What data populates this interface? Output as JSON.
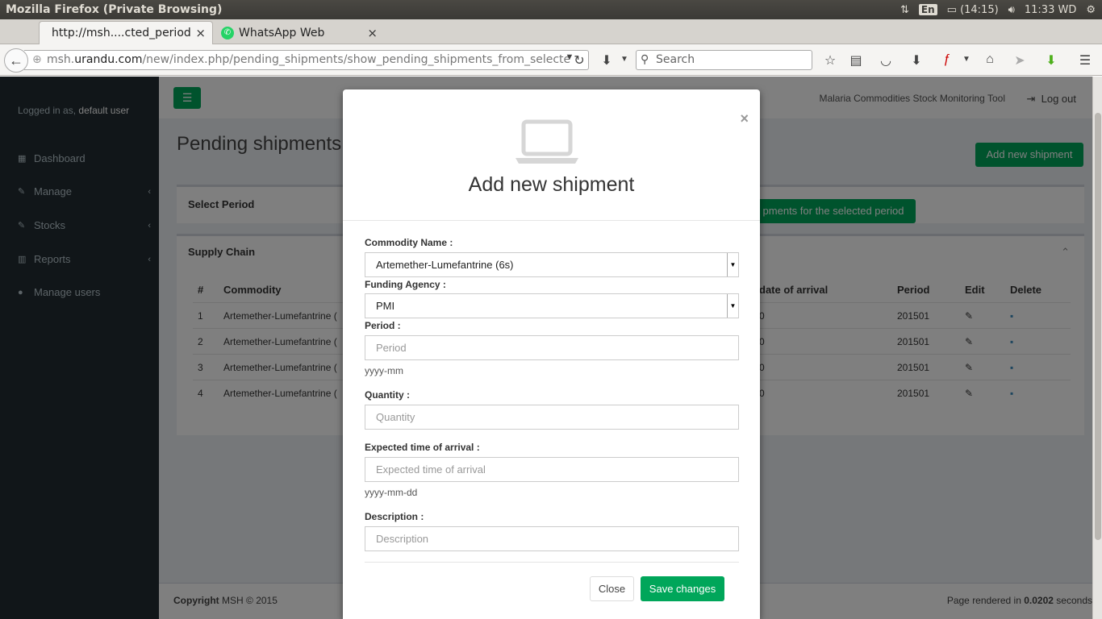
{
  "os": {
    "window_title": "Mozilla Firefox (Private Browsing)",
    "lang": "En",
    "battery": "(14:15)",
    "clock": "11:33 WD"
  },
  "tabs": [
    {
      "title": "http://msh....cted_period",
      "close": "×"
    },
    {
      "title": "WhatsApp Web",
      "close": "×"
    }
  ],
  "nav": {
    "url_prefix": "msh.",
    "url_domain": "urandu.com",
    "url_path": "/new/index.php/pending_shipments/show_pending_shipments_from_selecte",
    "search_placeholder": "Search"
  },
  "sidebar": {
    "logged_prefix": "Logged in as,",
    "user": "default user",
    "items": [
      {
        "label": "Dashboard",
        "chev": ""
      },
      {
        "label": "Manage",
        "chev": "‹"
      },
      {
        "label": "Stocks",
        "chev": "‹"
      },
      {
        "label": "Reports",
        "chev": "‹"
      },
      {
        "label": "Manage users",
        "chev": ""
      }
    ]
  },
  "header": {
    "app_title": "Malaria Commodities Stock Monitoring Tool",
    "logout": "Log out"
  },
  "page": {
    "title": "Pending shipments",
    "add_button": "Add new shipment",
    "select_period": "Select Period",
    "show_button": "pments for the selected period",
    "supply_chain": "Supply Chain",
    "columns": {
      "num": "#",
      "commodity": "Commodity",
      "arrival": "date of arrival",
      "period": "Period",
      "edit": "Edit",
      "delete": "Delete"
    },
    "rows": [
      {
        "num": "1",
        "commodity": "Artemether-Lumefantrine (",
        "arrival": "0",
        "period": "201501"
      },
      {
        "num": "2",
        "commodity": "Artemether-Lumefantrine (",
        "arrival": "0",
        "period": "201501"
      },
      {
        "num": "3",
        "commodity": "Artemether-Lumefantrine (",
        "arrival": "0",
        "period": "201501"
      },
      {
        "num": "4",
        "commodity": "Artemether-Lumefantrine (",
        "arrival": "0",
        "period": "201501"
      }
    ]
  },
  "footer": {
    "copyright_label": "Copyright",
    "copyright_text": "MSH © 2015",
    "rendered_prefix": "Page rendered in",
    "rendered_value": "0.0202",
    "rendered_suffix": "seconds"
  },
  "modal": {
    "close_x": "×",
    "title": "Add new shipment",
    "commodity_label": "Commodity Name :",
    "commodity_value": "Artemether-Lumefantrine (6s)",
    "funding_label": "Funding Agency :",
    "funding_value": "PMI",
    "period_label": "Period :",
    "period_placeholder": "Period",
    "period_hint": "yyyy-mm",
    "quantity_label": "Quantity :",
    "quantity_placeholder": "Quantity",
    "eta_label": "Expected time of arrival :",
    "eta_placeholder": "Expected time of arrival",
    "eta_hint": "yyyy-mm-dd",
    "desc_label": "Description :",
    "desc_placeholder": "Description",
    "close_button": "Close",
    "save_button": "Save changes"
  },
  "colors": {
    "accent": "#00a65a",
    "sidebar": "#222d32"
  }
}
